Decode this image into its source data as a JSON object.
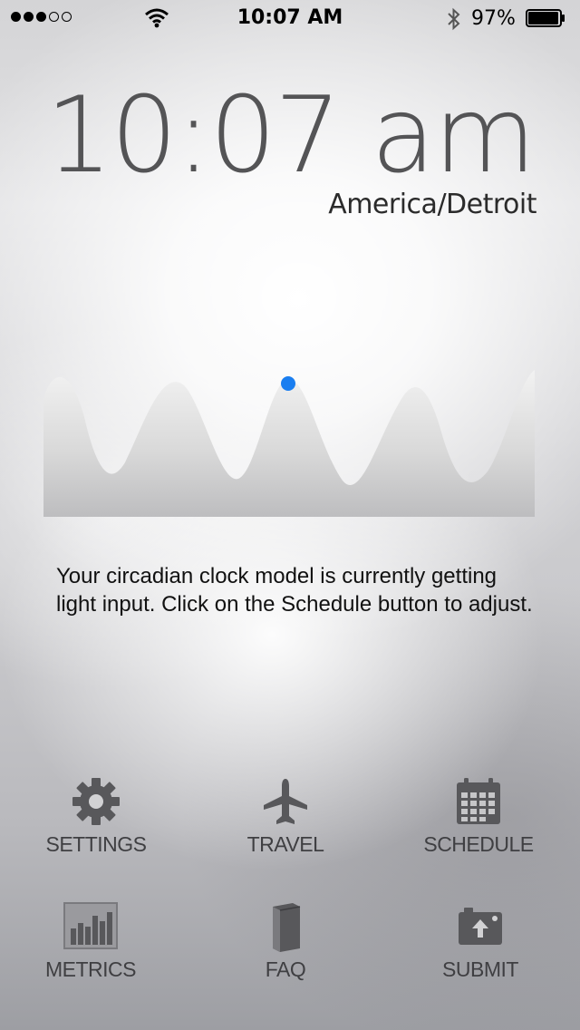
{
  "status_bar": {
    "carrier_dots_filled": 3,
    "carrier_dots_total": 5,
    "time": "10:07 AM",
    "battery_percent": "97%",
    "battery_level": 0.97,
    "icons": [
      "signal-dots",
      "wifi-icon",
      "bluetooth-icon",
      "battery-icon"
    ]
  },
  "clock": {
    "time": "10:07 am",
    "timezone": "America/Detroit"
  },
  "circadian": {
    "indicator_color": "#1a7ef0",
    "wave_color": "#d6d6d6"
  },
  "message": "Your circadian clock model is currently getting light input. Click on the Schedule button to adjust.",
  "menu": [
    {
      "label": "SETTINGS",
      "icon": "gear-icon"
    },
    {
      "label": "TRAVEL",
      "icon": "airplane-icon"
    },
    {
      "label": "SCHEDULE",
      "icon": "calendar-icon"
    },
    {
      "label": "METRICS",
      "icon": "bar-chart-icon"
    },
    {
      "label": "FAQ",
      "icon": "book-icon"
    },
    {
      "label": "SUBMIT",
      "icon": "camera-upload-icon"
    }
  ]
}
